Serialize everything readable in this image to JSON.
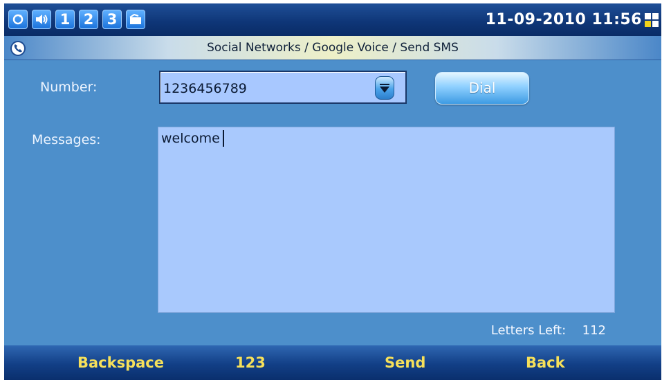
{
  "status_bar": {
    "icons": [
      "refresh-icon",
      "speaker-icon",
      "line-1-icon",
      "line-2-icon",
      "line-3-icon",
      "folder-icon"
    ],
    "line_1": "1",
    "line_2": "2",
    "line_3": "3",
    "datetime": "11-09-2010 11:56",
    "network_icon": "network-status-icon"
  },
  "breadcrumb": {
    "icon": "phone-icon",
    "text": "Social Networks / Google Voice / Send SMS"
  },
  "form": {
    "number_label": "Number:",
    "number_value": "1236456789",
    "dial_label": "Dial",
    "messages_label": "Messages:",
    "message_value": "welcome",
    "letters_left_label": "Letters Left:",
    "letters_left_value": "112"
  },
  "softkeys": {
    "backspace": "Backspace",
    "input_mode": "123",
    "send": "Send",
    "back": "Back"
  },
  "colors": {
    "panel": "#4d8fcb",
    "field": "#a8c8ff",
    "softkey_text": "#f6e05a",
    "status_bar": "#0e3576"
  }
}
